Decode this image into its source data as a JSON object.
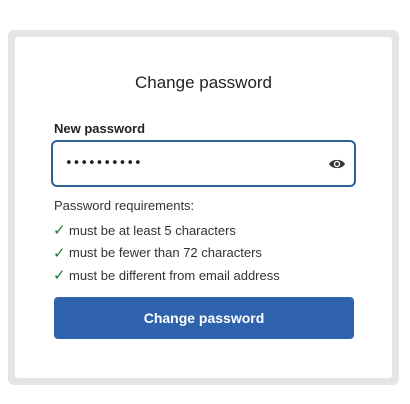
{
  "form": {
    "title": "Change password",
    "password_label": "New password",
    "password_value": "••••••••••",
    "toggle_icon": "eye-icon",
    "requirements_heading": "Password requirements:",
    "requirements": [
      {
        "check": "✓",
        "text": "must be at least 5 characters"
      },
      {
        "check": "✓",
        "text": "must be fewer than 72 characters"
      },
      {
        "check": "✓",
        "text": "must be different from email address"
      }
    ],
    "submit_label": "Change password"
  },
  "colors": {
    "accent": "#2f63ad",
    "focus_border": "#2e5f97",
    "check": "#1f7a3a",
    "frame": "#e5e5e5"
  }
}
